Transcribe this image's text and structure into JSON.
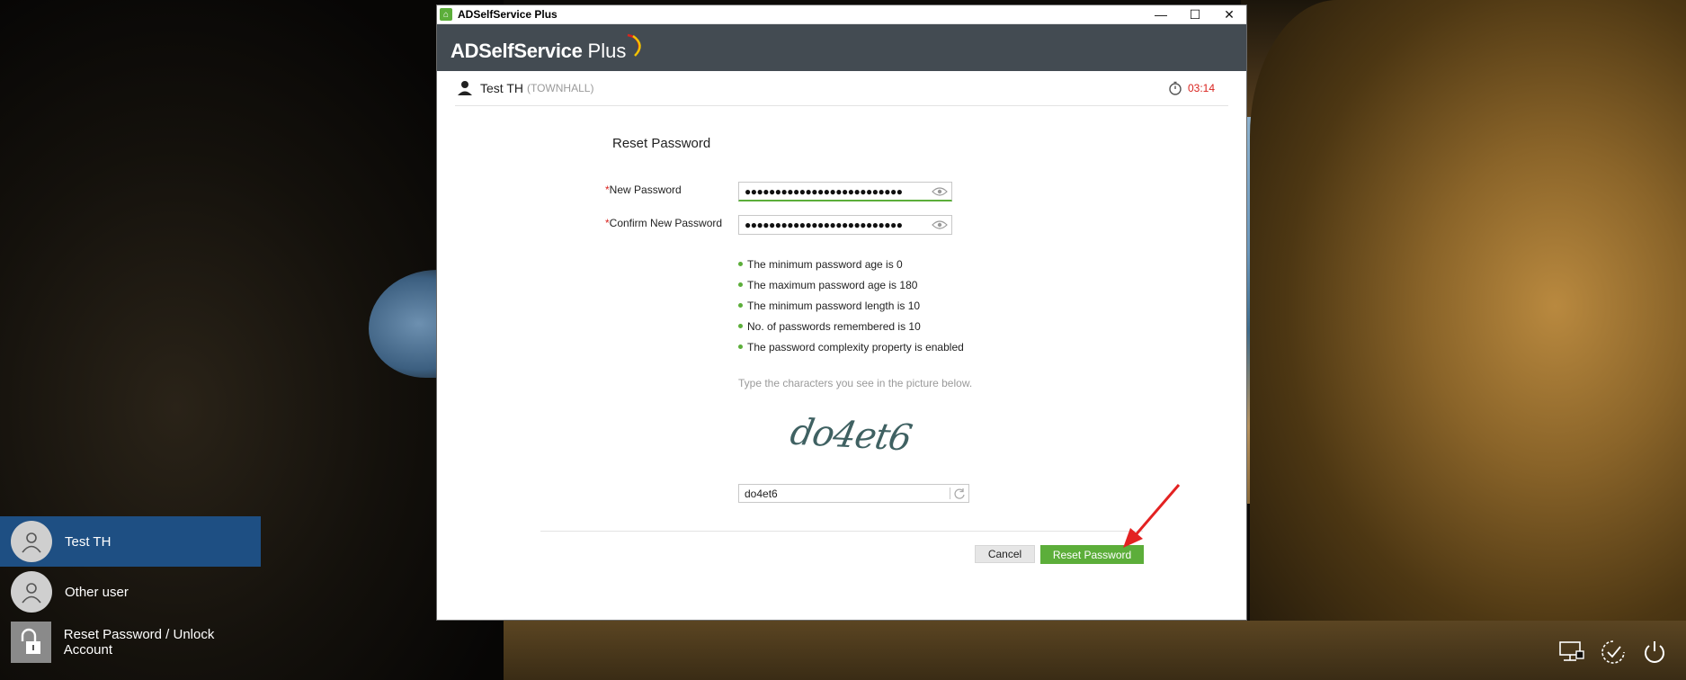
{
  "window": {
    "title": "ADSelfService Plus",
    "controls": {
      "minimize": "—",
      "maximize": "☐",
      "close": "✕"
    }
  },
  "header": {
    "brand": "ADSelfService",
    "plus": "Plus"
  },
  "userbar": {
    "name": "Test TH",
    "domain": "(TOWNHALL)",
    "timer": "03:14"
  },
  "form": {
    "title": "Reset Password",
    "new_password_label": "New Password",
    "confirm_password_label": "Confirm New Password",
    "required_mark": "*",
    "new_password_value": "●●●●●●●●●●●●●●●●●●●●●●●●●●",
    "confirm_password_value": "●●●●●●●●●●●●●●●●●●●●●●●●●●",
    "rules": [
      "The minimum password age is 0",
      "The maximum password age is 180",
      "The minimum password length is 10",
      "No. of passwords remembered is 10",
      "The password complexity property is enabled"
    ],
    "captcha_hint": "Type the characters you see in the picture below.",
    "captcha_text": "do4et6",
    "captcha_input_value": "do4et6",
    "cancel_label": "Cancel",
    "reset_label": "Reset Password"
  },
  "login_users": [
    {
      "label": "Test TH",
      "selected": true
    },
    {
      "label": "Other user",
      "selected": false
    },
    {
      "label": "Reset Password / Unlock Account",
      "selected": false
    }
  ],
  "colors": {
    "accent": "#5cae3a",
    "header": "#434b52",
    "timer": "#d9231e",
    "selected_user": "#1e4f83"
  }
}
